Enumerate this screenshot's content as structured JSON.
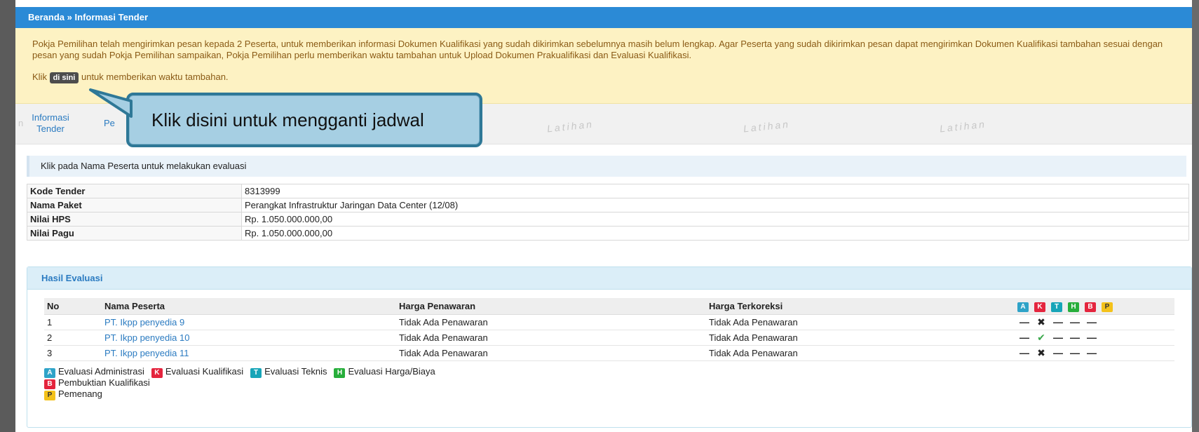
{
  "breadcrumb": {
    "home": "Beranda",
    "separator": "»",
    "current": "Informasi Tender"
  },
  "notice": {
    "message": "Pokja Pemilihan telah mengirimkan pesan kepada 2 Peserta, untuk memberikan informasi Dokumen Kualifikasi yang sudah dikirimkan sebelumnya masih belum lengkap. Agar Peserta yang sudah dikirimkan pesan dapat mengirimkan Dokumen Kualifikasi tambahan sesuai dengan pesan yang sudah Pokja Pemilihan sampaikan, Pokja Pemilihan perlu memberikan waktu tambahan untuk Upload Dokumen Prakualifikasi dan Evaluasi Kualifikasi.",
    "klik_prefix": "Klik",
    "link_label": "di sini",
    "klik_suffix": "untuk memberikan waktu tambahan."
  },
  "tabs": {
    "partial_left": "n",
    "informasi": "Informasi Tender",
    "partial_pe": "Pe"
  },
  "watermarks": [
    "Latihan",
    "Latihan",
    "Latihan"
  ],
  "callout": {
    "text": "Klik disini untuk mengganti jadwal"
  },
  "instruction": "Klik pada Nama Peserta untuk melakukan evaluasi",
  "info": [
    {
      "label": "Kode Tender",
      "value": "8313999"
    },
    {
      "label": "Nama Paket",
      "value": "Perangkat Infrastruktur Jaringan Data Center (12/08)"
    },
    {
      "label": "Nilai HPS",
      "value": "Rp. 1.050.000.000,00"
    },
    {
      "label": "Nilai Pagu",
      "value": "Rp. 1.050.000.000,00"
    }
  ],
  "hasil": {
    "title": "Hasil Evaluasi",
    "headers": {
      "no": "No",
      "nama": "Nama Peserta",
      "harga": "Harga Penawaran",
      "koreksi": "Harga Terkoreksi"
    },
    "badges": [
      "A",
      "K",
      "T",
      "H",
      "B",
      "P"
    ],
    "rows": [
      {
        "no": "1",
        "nama": "PT. Ikpp penyedia 9",
        "harga": "Tidak Ada Penawaran",
        "koreksi": "Tidak Ada Penawaran",
        "status": [
          "—",
          "✖",
          "—",
          "—",
          "—"
        ]
      },
      {
        "no": "2",
        "nama": "PT. Ikpp penyedia 10",
        "harga": "Tidak Ada Penawaran",
        "koreksi": "Tidak Ada Penawaran",
        "status": [
          "—",
          "✔",
          "—",
          "—",
          "—"
        ]
      },
      {
        "no": "3",
        "nama": "PT. Ikpp penyedia 11",
        "harga": "Tidak Ada Penawaran",
        "koreksi": "Tidak Ada Penawaran",
        "status": [
          "—",
          "✖",
          "—",
          "—",
          "—"
        ]
      }
    ],
    "legend": [
      {
        "badge": "A",
        "label": "Evaluasi Administrasi"
      },
      {
        "badge": "K",
        "label": "Evaluasi Kualifikasi"
      },
      {
        "badge": "T",
        "label": "Evaluasi Teknis"
      },
      {
        "badge": "H",
        "label": "Evaluasi Harga/Biaya"
      },
      {
        "badge": "B",
        "label": "Pembuktian Kualifikasi"
      },
      {
        "badge": "P",
        "label": "Pemenang"
      }
    ]
  },
  "colors": {
    "header_bar": "#2b8ad6",
    "notice_bg": "#fdf2c3",
    "callout_bg": "#a6cfe3",
    "callout_border": "#2e7897",
    "link": "#2b7bc1"
  }
}
